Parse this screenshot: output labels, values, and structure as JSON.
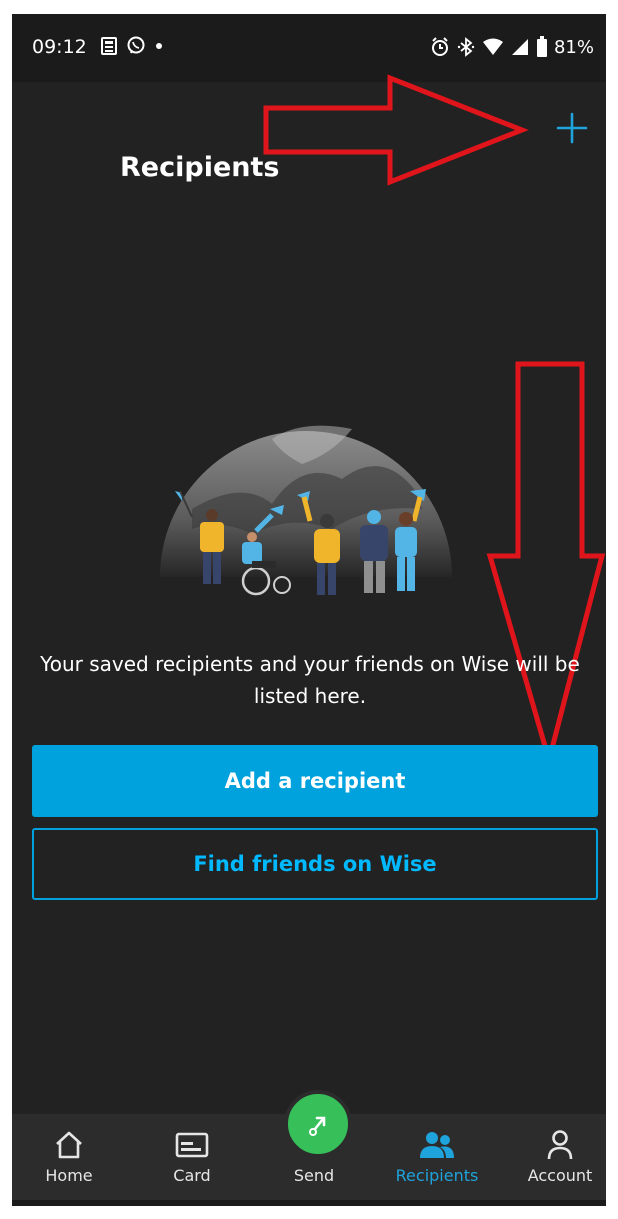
{
  "status_bar": {
    "time": "09:12",
    "battery": "81%"
  },
  "header": {
    "title": "Recipients",
    "add_icon": "plus-icon"
  },
  "empty_state": {
    "message": "Your saved recipients and your friends on Wise will be listed here."
  },
  "actions": {
    "add_recipient": "Add a recipient",
    "find_friends": "Find friends on Wise"
  },
  "nav": {
    "items": [
      {
        "label": "Home",
        "icon": "home-icon"
      },
      {
        "label": "Card",
        "icon": "card-icon"
      },
      {
        "label": "Send",
        "icon": "send-icon"
      },
      {
        "label": "Recipients",
        "icon": "recipients-icon",
        "active": true
      },
      {
        "label": "Account",
        "icon": "account-icon"
      }
    ]
  },
  "colors": {
    "background": "#222222",
    "accent": "#00a2dd",
    "send": "#37c05a",
    "annotation": "#e0151c"
  }
}
